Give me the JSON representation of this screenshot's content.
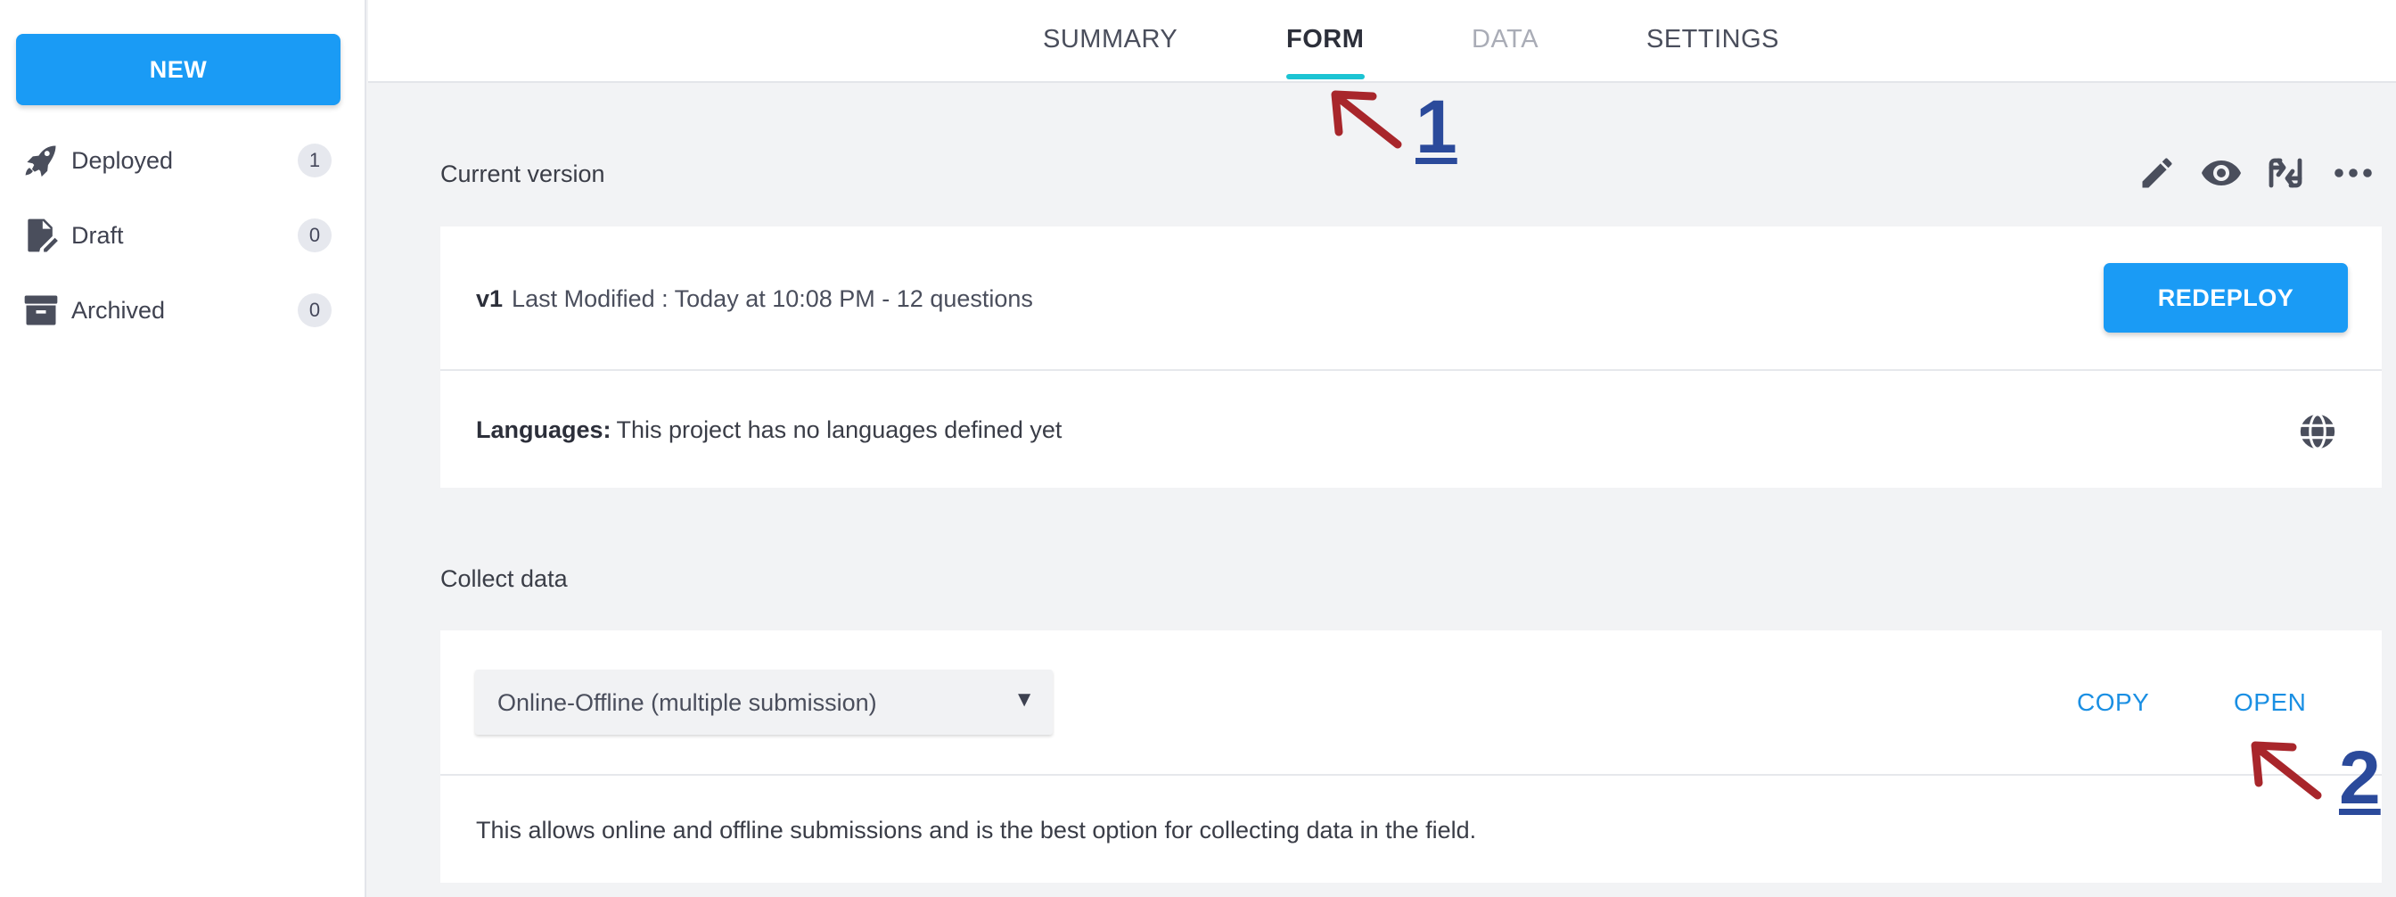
{
  "sidebar": {
    "new_label": "NEW",
    "items": [
      {
        "label": "Deployed",
        "count": "1",
        "icon": "rocket-icon"
      },
      {
        "label": "Draft",
        "count": "0",
        "icon": "draft-icon"
      },
      {
        "label": "Archived",
        "count": "0",
        "icon": "archive-icon"
      }
    ]
  },
  "tabs": [
    {
      "label": "SUMMARY",
      "state": "normal"
    },
    {
      "label": "FORM",
      "state": "active"
    },
    {
      "label": "DATA",
      "state": "disabled"
    },
    {
      "label": "SETTINGS",
      "state": "normal"
    }
  ],
  "annotations": {
    "first": "1",
    "second": "2",
    "arrow_color": "#a8262b",
    "number_color": "#2b4a9b"
  },
  "current_version": {
    "title": "Current version",
    "tools": [
      "edit-icon",
      "preview-icon",
      "replace-icon",
      "more-icon"
    ],
    "version": "v1",
    "meta": "Last Modified : Today at 10:08 PM - 12 questions",
    "redeploy_label": "REDEPLOY",
    "languages_label": "Languages:",
    "languages_text": "This project has no languages defined yet",
    "languages_icon": "globe-icon"
  },
  "collect": {
    "title": "Collect data",
    "select_value": "Online-Offline (multiple submission)",
    "copy_label": "COPY",
    "open_label": "OPEN",
    "description": "This allows online and offline submissions and is the best option for collecting data in the field."
  },
  "colors": {
    "accent": "#1a9bf5",
    "tab_underline": "#1cc4d3",
    "link": "#1a8fe3"
  }
}
